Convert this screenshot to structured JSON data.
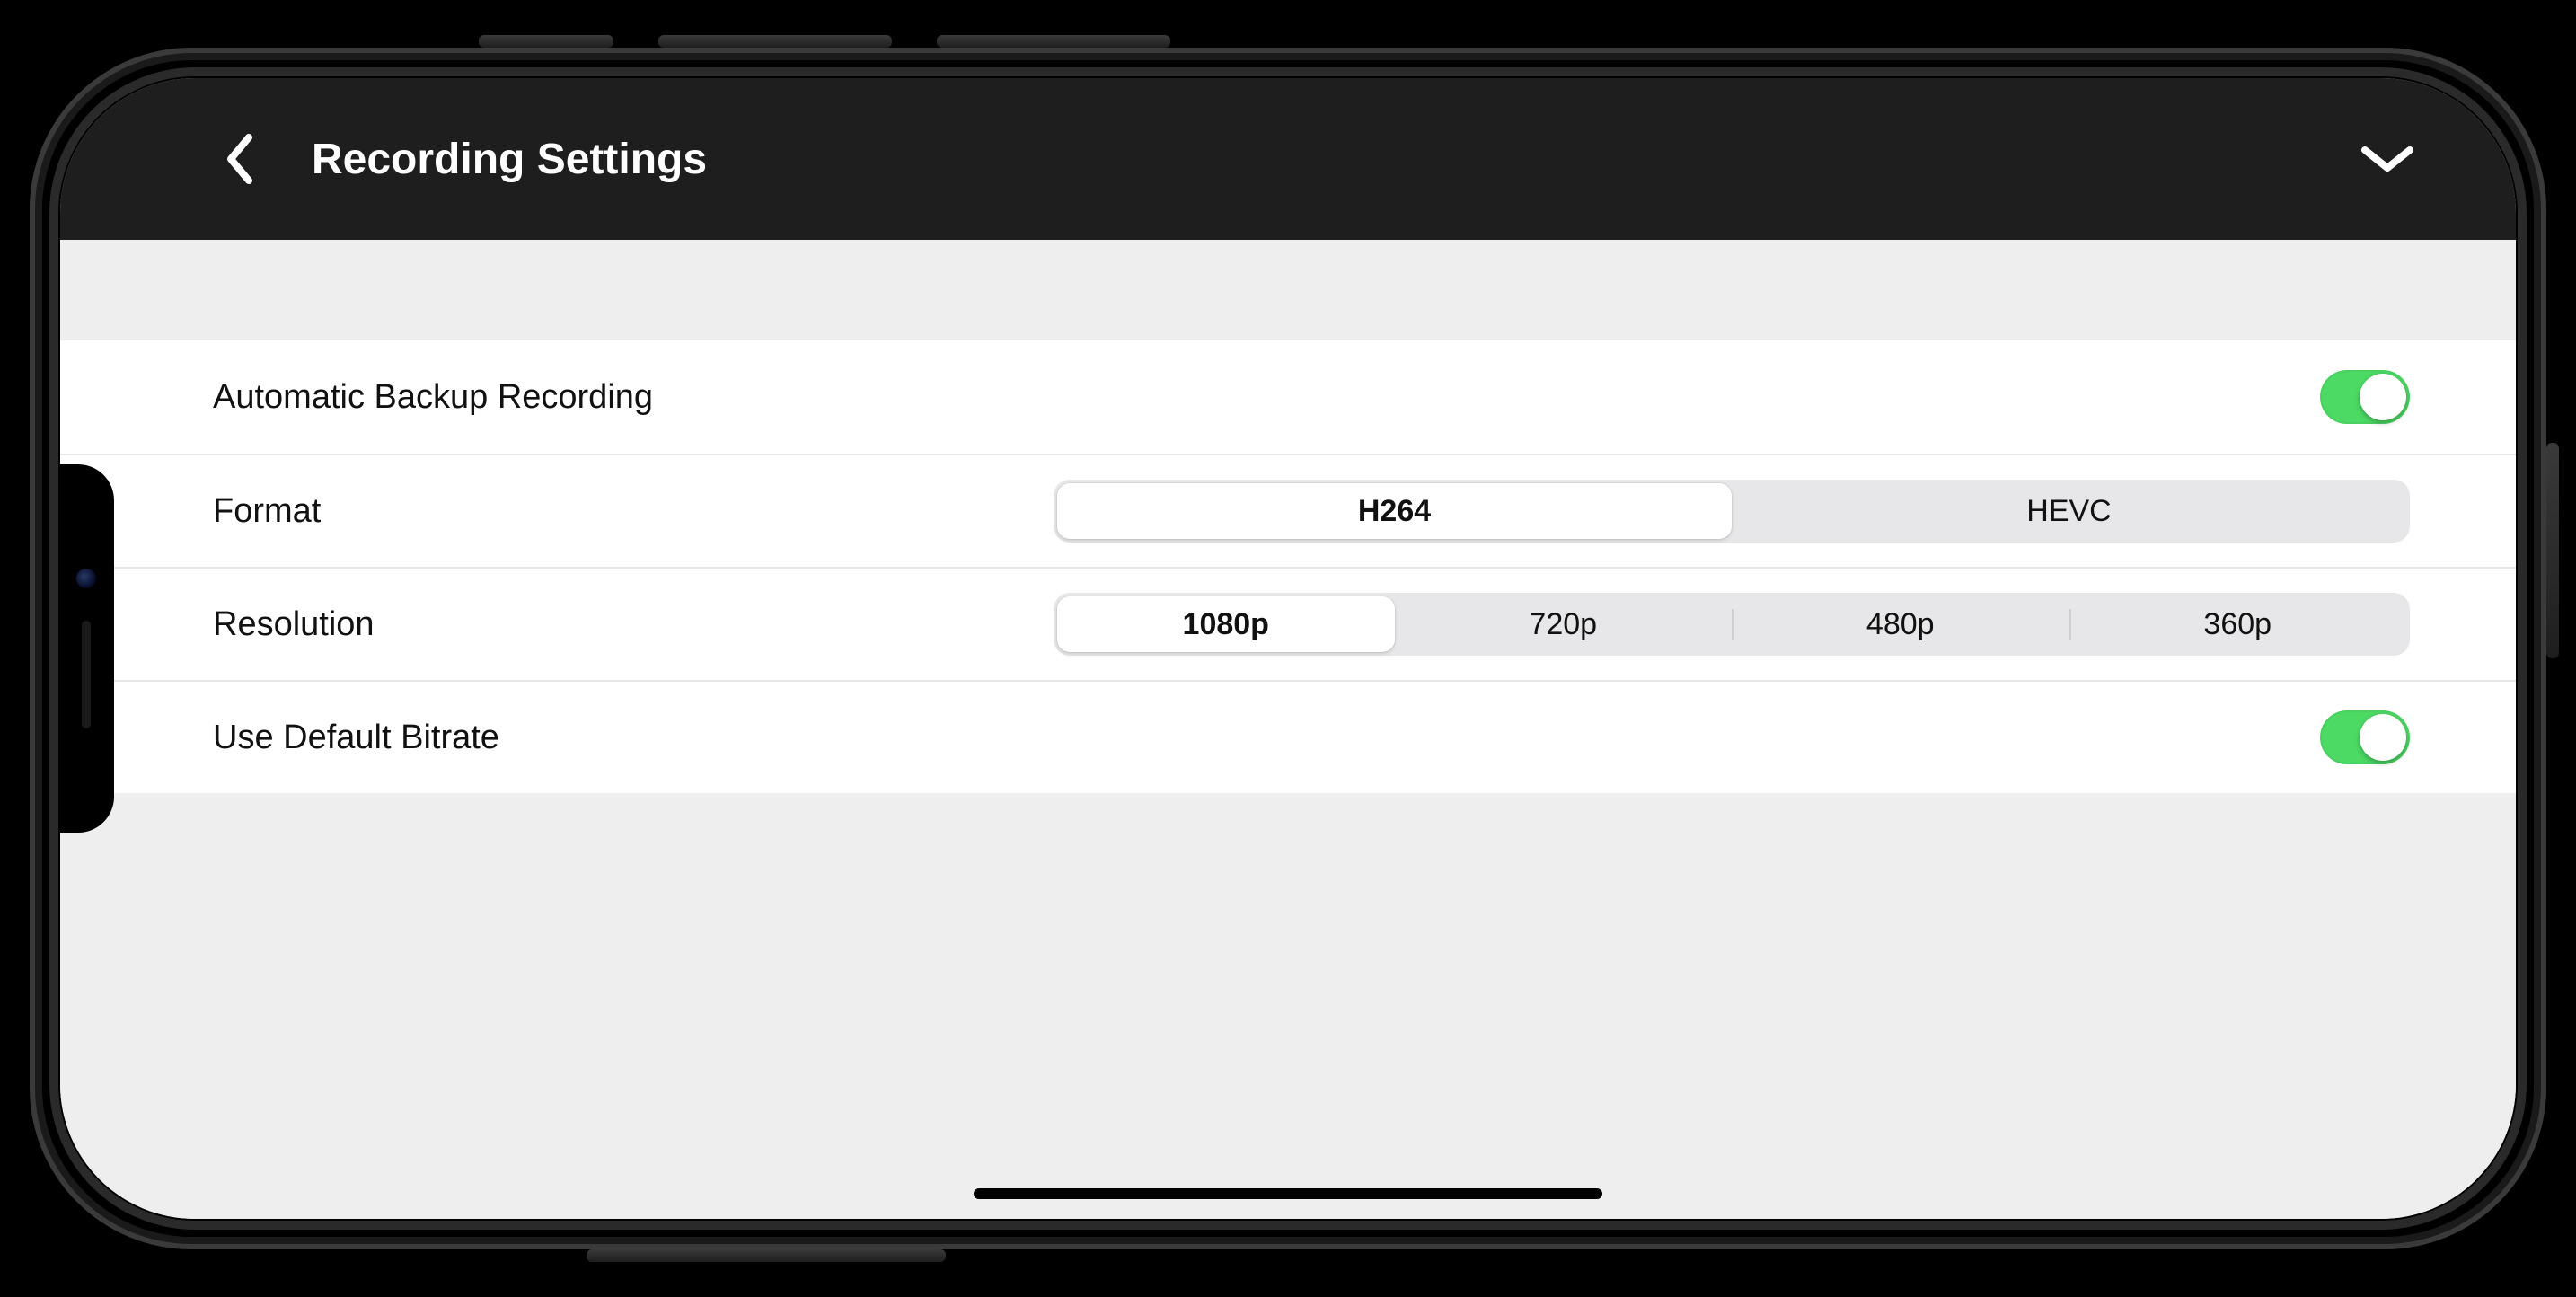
{
  "header": {
    "title": "Recording Settings"
  },
  "rows": {
    "backup": {
      "label": "Automatic Backup Recording",
      "on": true
    },
    "format": {
      "label": "Format",
      "options": [
        "H264",
        "HEVC"
      ],
      "selected": "H264"
    },
    "resolution": {
      "label": "Resolution",
      "options": [
        "1080p",
        "720p",
        "480p",
        "360p"
      ],
      "selected": "1080p"
    },
    "bitrate": {
      "label": "Use Default Bitrate",
      "on": true
    }
  },
  "colors": {
    "toggle_on": "#4cd964",
    "header_bg": "#1e1e1e",
    "page_bg": "#eeeeee"
  }
}
